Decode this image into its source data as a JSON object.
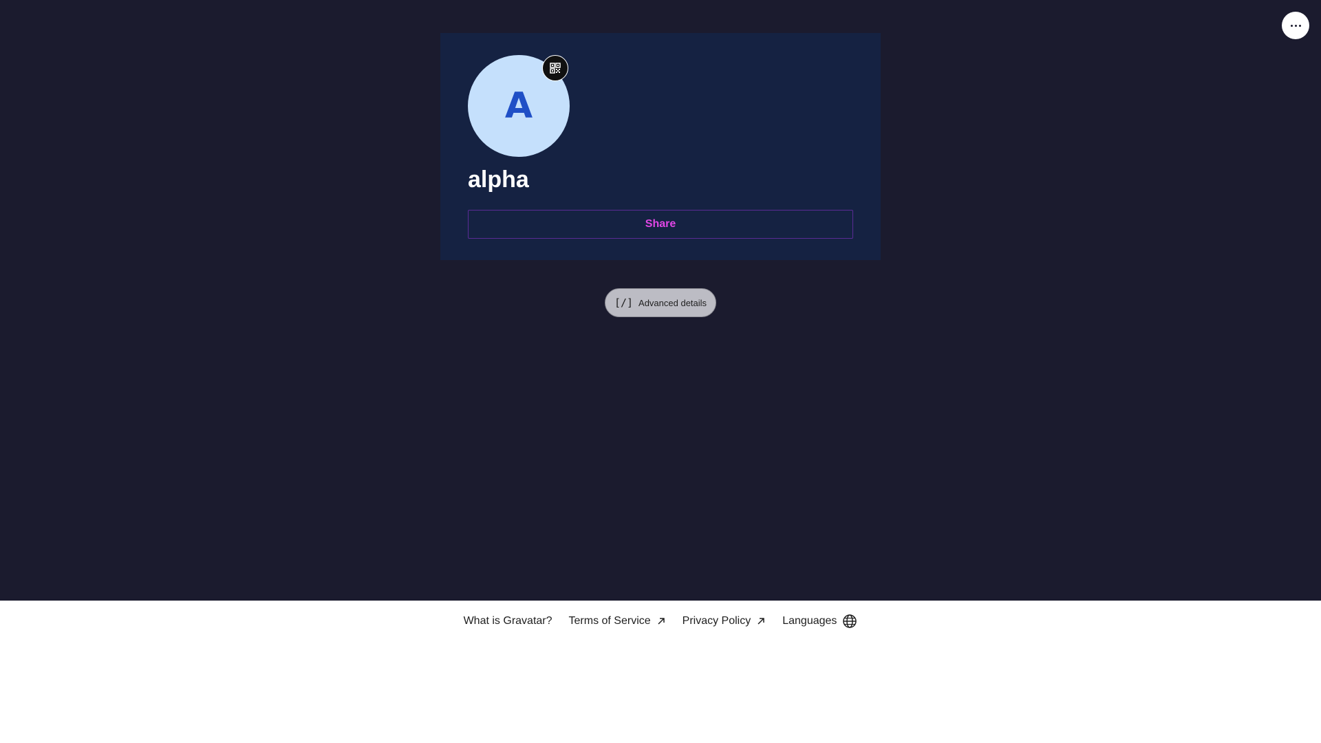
{
  "header": {
    "more_icon": "more-horizontal-icon"
  },
  "profile": {
    "avatar_initial": "A",
    "avatar_bg": "#c5e0fc",
    "avatar_fg": "#1f4fc6",
    "qr_icon": "qr-code-icon",
    "display_name": "alpha",
    "share_label": "Share",
    "share_color": "#e046e6"
  },
  "advanced": {
    "icon": "code-brackets-icon",
    "icon_glyph": "[/]",
    "label": "Advanced details"
  },
  "footer": {
    "links": [
      {
        "label": "What is Gravatar?"
      },
      {
        "label": "Terms of Service",
        "icon": "external-link-icon"
      },
      {
        "label": "Privacy Policy",
        "icon": "external-link-icon"
      },
      {
        "label": "Languages",
        "icon": "globe-icon"
      }
    ]
  },
  "colors": {
    "page_bg": "#1b1b2e",
    "card_bg": "#152242",
    "footer_bg": "#ffffff"
  }
}
